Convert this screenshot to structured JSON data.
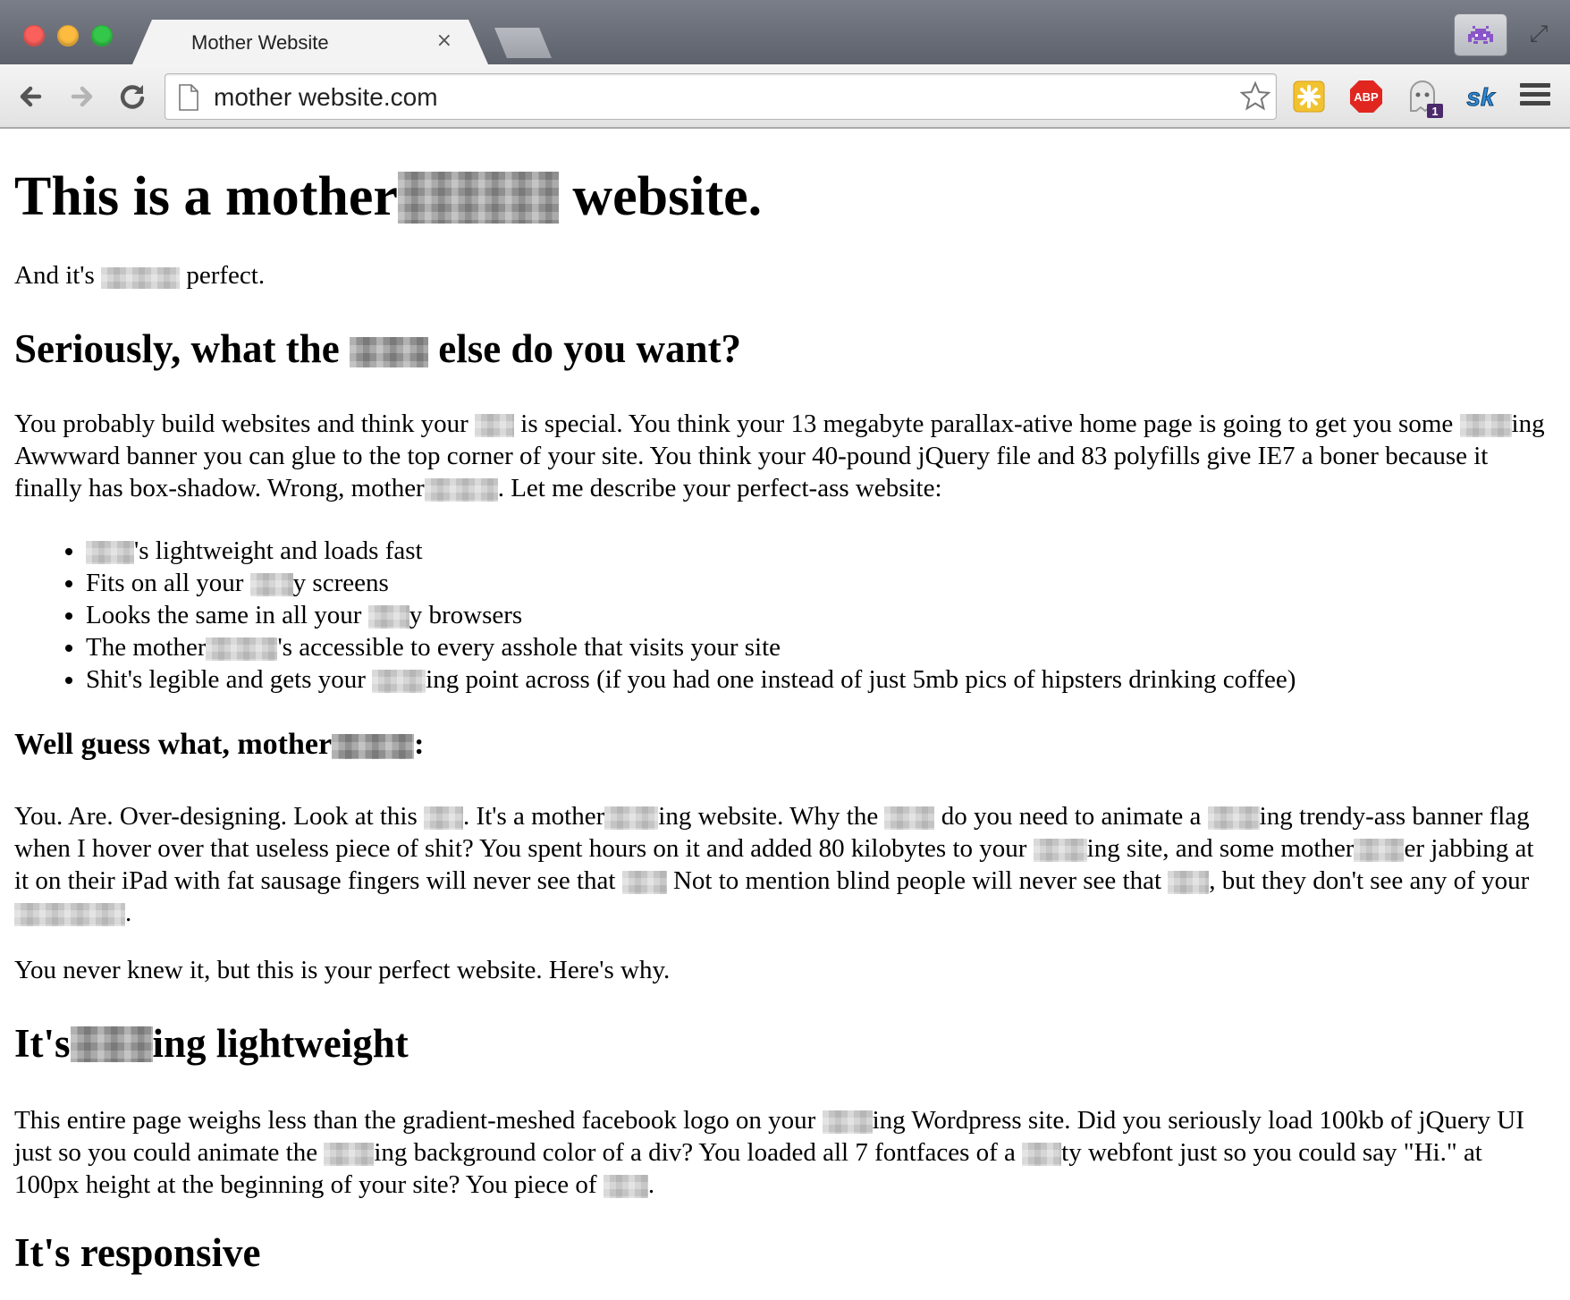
{
  "browser": {
    "tab_title": "Mother Website",
    "tab_close": "×",
    "url": "mother website.com",
    "extensions": [
      "puzzle-extension",
      "adblock-plus",
      "ghostery",
      "sk-extension"
    ],
    "abp_label": "ABP",
    "ghostery_badge": "1",
    "sk_label": "sk"
  },
  "page": {
    "title_a": "This is a mother",
    "title_b": " website.",
    "intro_a": "And it's ",
    "intro_b": " perfect.",
    "h_serious_a": "Seriously, what the ",
    "h_serious_b": " else do you want?",
    "p1": {
      "a": "You probably build websites and think your ",
      "b": " is special. You think your 13 megabyte parallax-ative home page is going to get you some ",
      "c": "ing Awwward banner you can glue to the top corner of your site. You think your 40-pound jQuery file and 83 polyfills give IE7 a boner because it finally has box-shadow. Wrong, mother",
      "d": ". Let me describe your perfect-ass website:"
    },
    "list": {
      "i1_b": "'s lightweight and loads fast",
      "i2_a": "Fits on all your ",
      "i2_b": "y screens",
      "i3_a": "Looks the same in all your ",
      "i3_b": "y browsers",
      "i4_a": "The mother",
      "i4_b": "'s accessible to every asshole that visits your site",
      "i5_a": "Shit's legible and gets your ",
      "i5_b": "ing point across (if you had one instead of just 5mb pics of hipsters drinking coffee)"
    },
    "h_guess_a": "Well guess what, mother",
    "h_guess_b": ":",
    "p2": {
      "a": "You. Are. Over-designing. Look at this ",
      "b": ". It's a mother",
      "c": "ing website. Why the ",
      "d": " do you need to animate a ",
      "e": "ing trendy-ass banner flag when I hover over that useless piece of shit? You spent hours on it and added 80 kilobytes to your ",
      "f": "ing site, and some mother",
      "g": "er jabbing at it on their iPad with fat sausage fingers will never see that ",
      "h": " Not to mention blind people will never see that ",
      "i": ", but they don't see any of your ",
      "j": "."
    },
    "p3": "You never knew it, but this is your perfect website. Here's why.",
    "h_light_a": "It's",
    "h_light_b": "ing lightweight",
    "p4": {
      "a": "This entire page weighs less than the gradient-meshed facebook logo on your ",
      "b": "ing Wordpress site. Did you seriously load 100kb of jQuery UI just so you could animate the ",
      "c": "ing background color of a div? You loaded all 7 fontfaces of a ",
      "d": "ty webfont just so you could say \"Hi.\" at 100px height at the beginning of your site? You piece of ",
      "e": "."
    },
    "h_responsive": "It's responsive"
  }
}
